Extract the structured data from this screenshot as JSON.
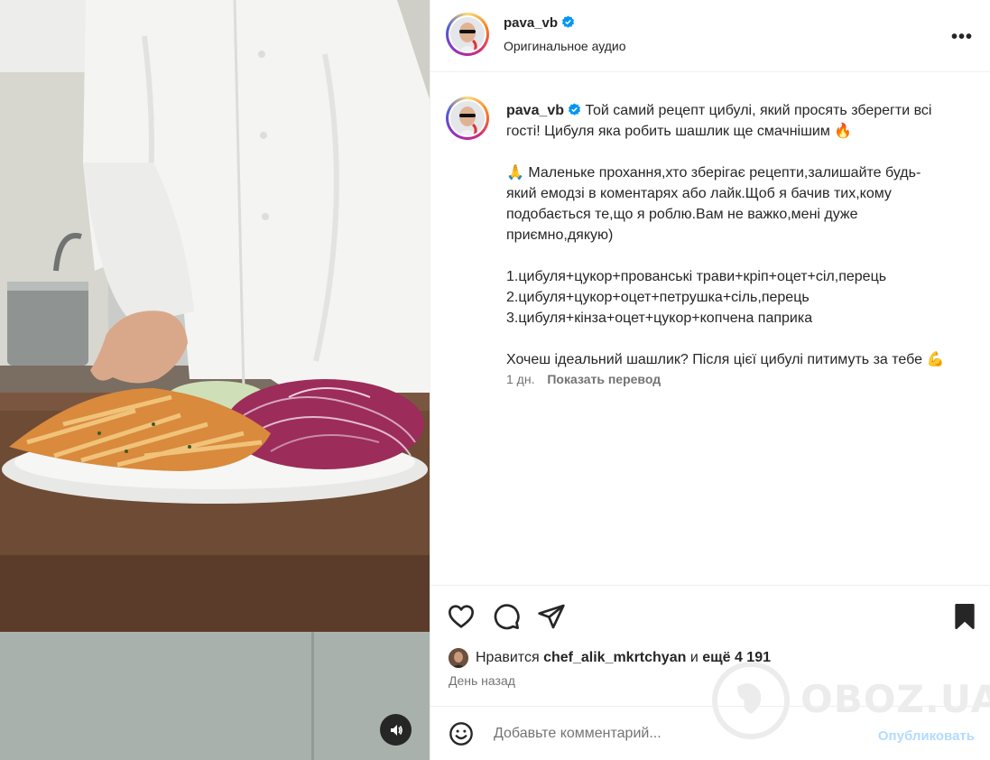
{
  "post": {
    "username": "pava_vb",
    "audio": "Оригинальное аудио",
    "more_label": "•••",
    "caption_lines": [
      "Той самий рецепт цибулі, який просять зберегти всі",
      "гості! Цибуля яка робить шашлик ще смачнішим 🔥"
    ],
    "request_lines": [
      "🙏 Маленьке прохання,хто зберігає рецепти,залишайте будь-",
      "який емодзі в коментарях або лайк.Щоб я бачив тих,кому",
      "подобається те,що я роблю.Вам не важко,мені дуже",
      "приємно,дякую)"
    ],
    "recipes": [
      "1.цибуля+цукор+прованські трави+кріп+оцет+сіл,перець",
      "2.цибуля+цукор+оцет+петрушка+сіль,перець",
      "3.цибуля+кінза+оцет+цукор+копчена паприка"
    ],
    "closing": "Хочеш ідеальний шашлик? Після цієї цибулі питимуть за тебе 💪",
    "age": "1 дн.",
    "translate": "Показать перевод"
  },
  "likes": {
    "prefix": "Нравится",
    "liker": "chef_alik_mkrtchyan",
    "middle": "и",
    "others": "ещё 4 191"
  },
  "date": "День назад",
  "comment": {
    "placeholder": "Добавьте комментарий...",
    "publish": "Опубликовать"
  },
  "watermark": "OBOZ.UA",
  "icons": {
    "like": "heart-icon",
    "comment": "comment-bubble-icon",
    "share": "paper-plane-icon",
    "save": "bookmark-icon",
    "emoji": "emoji-smile-icon",
    "mute": "speaker-icon",
    "verified": "verified-badge-icon"
  },
  "colors": {
    "verified": "#0095f6",
    "publish": "#b3dbff",
    "muted_text": "#737373"
  }
}
